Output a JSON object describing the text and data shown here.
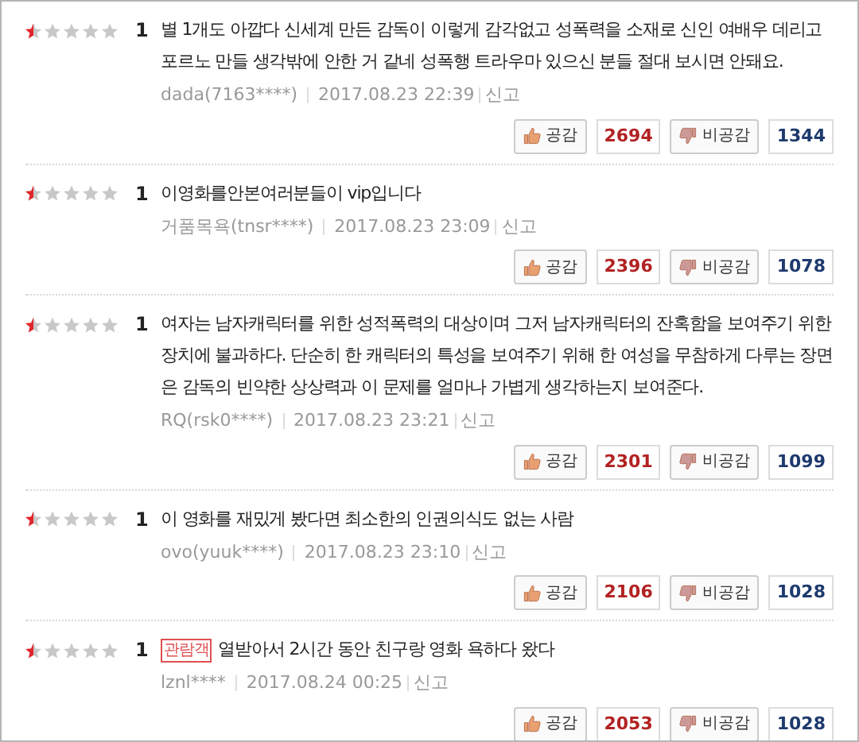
{
  "reviews": [
    {
      "stars": 0.5,
      "score": "1",
      "text": "별 1개도 아깝다 신세계 만든 감독이 이렇게 감각없고 성폭력을 소재로 신인 여배우 데리고 포르노 만들 생각밖에 안한 거 같네 성폭행 트라우마 있으신 분들 절대 보시면 안돼요.",
      "author": "dada(7163****)",
      "date": "2017.08.23 22:39",
      "report": "신고",
      "like_label": "공감",
      "likes": "2694",
      "dislike_label": "비공감",
      "dislikes": "1344"
    },
    {
      "stars": 0.5,
      "score": "1",
      "text": "이영화를안본여러분들이 vip입니다",
      "author": "거품목욕(tnsr****)",
      "date": "2017.08.23 23:09",
      "report": "신고",
      "like_label": "공감",
      "likes": "2396",
      "dislike_label": "비공감",
      "dislikes": "1078"
    },
    {
      "stars": 0.5,
      "score": "1",
      "text": "여자는 남자캐릭터를 위한 성적폭력의 대상이며 그저 남자캐릭터의 잔혹함을 보여주기 위한 장치에 불과하다. 단순히 한 캐릭터의 특성을 보여주기 위해 한 여성을 무참하게 다루는 장면은 감독의 빈약한 상상력과 이 문제를 얼마나 가볍게 생각하는지 보여준다.",
      "author": "RQ(rsk0****)",
      "date": "2017.08.23 23:21",
      "report": "신고",
      "like_label": "공감",
      "likes": "2301",
      "dislike_label": "비공감",
      "dislikes": "1099"
    },
    {
      "stars": 0.5,
      "score": "1",
      "text": "이 영화를 재밌게 봤다면 최소한의 인권의식도 없는 사람",
      "author": "ovo(yuuk****)",
      "date": "2017.08.23 23:10",
      "report": "신고",
      "like_label": "공감",
      "likes": "2106",
      "dislike_label": "비공감",
      "dislikes": "1028"
    },
    {
      "stars": 0.5,
      "score": "1",
      "badge": "관람객",
      "text": "열받아서 2시간 동안 친구랑 영화 욕하다 왔다",
      "author": "lznl****",
      "date": "2017.08.24 00:25",
      "report": "신고",
      "like_label": "공감",
      "likes": "2053",
      "dislike_label": "비공감",
      "dislikes": "1028"
    }
  ]
}
